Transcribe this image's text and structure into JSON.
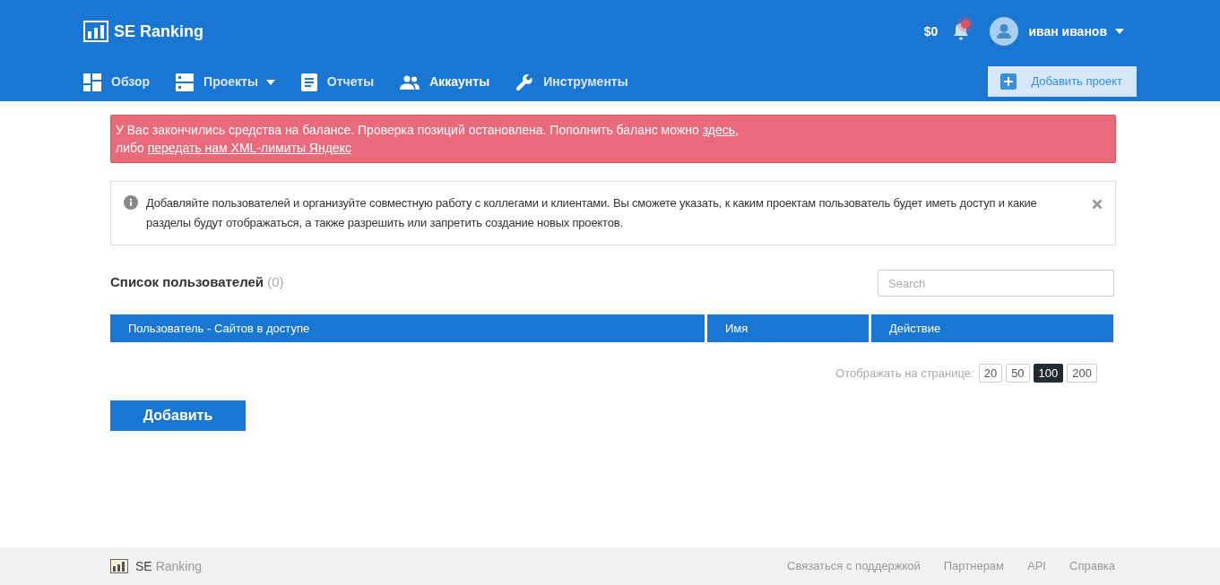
{
  "header": {
    "logo": "SE Ranking",
    "balance": "$0",
    "notifications_unread": true,
    "user_name": "иван иванов"
  },
  "nav": [
    {
      "kind": "dashboard",
      "label": "Обзор",
      "selected": false,
      "dropdown": false
    },
    {
      "kind": "projects",
      "label": "Проекты",
      "selected": false,
      "dropdown": true
    },
    {
      "kind": "reports",
      "label": "Отчеты",
      "selected": false,
      "dropdown": false
    },
    {
      "kind": "accounts",
      "label": "Аккаунты",
      "selected": true,
      "dropdown": false
    },
    {
      "kind": "tools",
      "label": "Инструменты",
      "selected": false,
      "dropdown": false
    }
  ],
  "add_project_button": "Добавить проект",
  "alert": {
    "text_before": "У Вас закончились средства на балансе. Проверка позиций остановлена. Пополнить баланс можно ",
    "link_1": "здесь",
    "text_after": ",",
    "line2_before": "либо ",
    "link_2": "передать нам XML-лимиты Яндекс"
  },
  "info": "Добавляйте пользователей и организуйте совместную работу с коллегами и клиентами. Вы сможете указать, к каким проектам пользователь будет иметь доступ и какие разделы будут отображаться, а также разрешить или запретить создание новых проектов.",
  "users": {
    "title": "Список пользователей",
    "count": "(0)",
    "search": {
      "placeholder": "Search"
    },
    "columns": [
      "Пользователь - Сайтов в доступе",
      "Имя",
      "Действие"
    ],
    "page_size_label": "Отображать на странице:",
    "page_sizes": [
      {
        "label": "20",
        "selected": false
      },
      {
        "label": "50",
        "selected": false
      },
      {
        "label": "100",
        "selected": true
      },
      {
        "label": "200",
        "selected": false
      }
    ],
    "add_button": "Добавить"
  },
  "footer": {
    "logo_strong": "SE",
    "logo_light": "Ranking",
    "links": [
      "Связаться с поддержкой",
      "Партнерам",
      "API",
      "Справка"
    ]
  }
}
